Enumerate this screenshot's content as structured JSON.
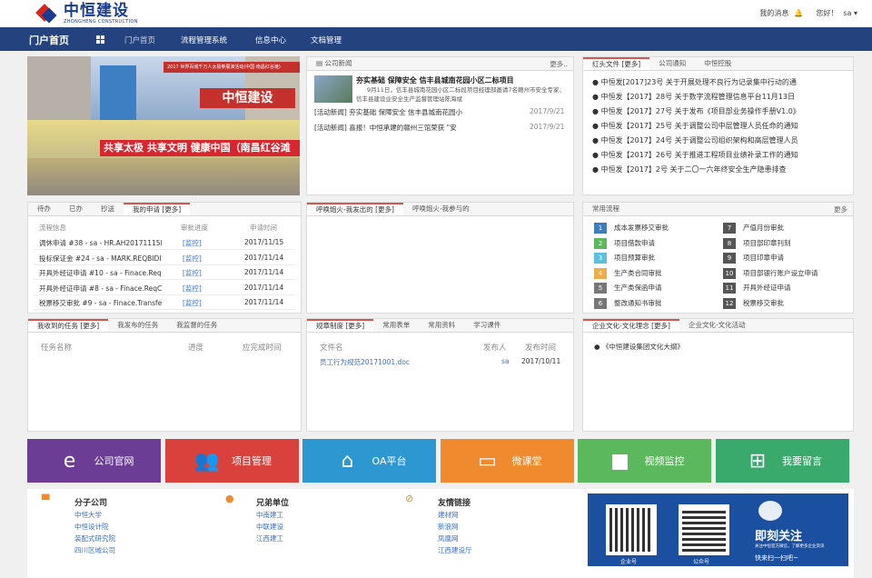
{
  "brand": {
    "cn": "中恒建设",
    "en": "ZHONGHENG CONSTRUCTION"
  },
  "user": {
    "messages": "我的消息",
    "greeting": "您好！",
    "name": "sa"
  },
  "nav": {
    "home": "门户首页",
    "items": [
      "门户首页",
      "流程管理系统",
      "信息中心",
      "文档管理"
    ]
  },
  "banner": {
    "headline": "共享太极 共享文明 健康中国（南昌红谷滩",
    "sign": "中恒建设",
    "top_strip": "2017 世界百城千万人太极拳展演活动(中国·南昌红谷滩)"
  },
  "company_news": {
    "title": "公司新闻",
    "more": "更多..",
    "featured_title": "夯实基础 保障安全 信丰县城南花园小区二标项目",
    "featured_text": "9月11日，信丰县城南花园小区二标段项目经理部邀请7名赣州市安全专家、信丰县建设业安全生产监督管理站陈海斌",
    "items": [
      {
        "text": "[活动新闻] 夯实基础 保障安全 信丰县城南花园小",
        "date": "2017/9/21"
      },
      {
        "text": "[活动新闻] 喜报！中恒承建的赣州三馆荣获 \"安",
        "date": "2017/9/21"
      }
    ]
  },
  "notices": {
    "tabs": [
      "红头文件 [更多]",
      "公司通知",
      "中恒控股"
    ],
    "items": [
      "中恒发[2017]23号 关于开展处理不良行为记录集中行动的通",
      "中恒发【2017】28号 关于数字流程管理信息平台11月13日",
      "中恒发【2017】27号 关于发布《项目部业务操作手册V1.0》",
      "中恒发【2017】25号 关于调整公司中层管理人员任命的通知",
      "中恒发【2017】24号 关于调整公司组织架构和高层管理人员",
      "中恒发【2017】26号 关于推进工程项目业绩补录工作的通知",
      "中恒发【2017】2号 关于二〇一六年终安全生产隐患排查"
    ]
  },
  "my_apply": {
    "tabs": [
      "待办",
      "已办",
      "抄送",
      "我的申请 [更多]"
    ],
    "headers": [
      "流程信息",
      "审批进度",
      "申请时间"
    ],
    "progress_label": "[监控]",
    "rows": [
      {
        "info": "调休申请 #38 - sa - HR.AH20171115I",
        "time": "2017/11/15"
      },
      {
        "info": "投标保证金 #24 - sa - MARK.REQBIDI",
        "time": "2017/11/14"
      },
      {
        "info": "开具外经证申请 #10 - sa - Finace.Req",
        "time": "2017/11/14"
      },
      {
        "info": "开具外经证申请 #8 - sa - Finace.ReqC",
        "time": "2017/11/14"
      },
      {
        "info": "税票移交审批 #9 - sa - Finace.Transfe",
        "time": "2017/11/14"
      }
    ]
  },
  "calls": {
    "tabs": [
      "呼唤炮火-我发出的 [更多]",
      "呼唤炮火-我参与的"
    ]
  },
  "common_flows": {
    "title": "常用流程",
    "more": "更多",
    "items": [
      {
        "n": "1",
        "label": "成本发票移交审批",
        "color": "#3b7dbf"
      },
      {
        "n": "2",
        "label": "项目借款申请",
        "color": "#5cb85c"
      },
      {
        "n": "3",
        "label": "项目预算审批",
        "color": "#5bc0de"
      },
      {
        "n": "4",
        "label": "生产类合同审批",
        "color": "#f0ad4e"
      },
      {
        "n": "5",
        "label": "生产类保函申请",
        "color": "#777777"
      },
      {
        "n": "6",
        "label": "整改通知书审批",
        "color": "#777777"
      },
      {
        "n": "7",
        "label": "产值月份审批",
        "color": "#555555"
      },
      {
        "n": "8",
        "label": "项目部印章刊刻",
        "color": "#555555"
      },
      {
        "n": "9",
        "label": "项目印章申请",
        "color": "#555555"
      },
      {
        "n": "10",
        "label": "项目部银行账户设立申请",
        "color": "#555555"
      },
      {
        "n": "11",
        "label": "开具外经证申请",
        "color": "#555555"
      },
      {
        "n": "12",
        "label": "税票移交审批",
        "color": "#555555"
      }
    ]
  },
  "tasks": {
    "tabs": [
      "我收到的任务 [更多]",
      "我发布的任务",
      "我监督的任务"
    ],
    "headers": [
      "任务名称",
      "进度",
      "应完成时间"
    ]
  },
  "rules": {
    "tabs": [
      "规章制度 [更多]",
      "常用表单",
      "常用资料",
      "学习课件"
    ],
    "headers": [
      "文件名",
      "发布人",
      "发布时间"
    ],
    "rows": [
      {
        "name": "员工行为规范20171001.doc",
        "by": "sa",
        "date": "2017/10/11"
      }
    ]
  },
  "culture": {
    "tabs": [
      "企业文化-文化理念 [更多]",
      "企业文化-文化活动"
    ],
    "items": [
      "《中恒建设集团文化大纲》"
    ]
  },
  "tiles": [
    {
      "label": "公司官网",
      "color": "#6b3d95",
      "icon": "ie-icon"
    },
    {
      "label": "项目管理",
      "color": "#d9413d",
      "icon": "people-icon"
    },
    {
      "label": "OA平台",
      "color": "#2d97d1",
      "icon": "home-icon"
    },
    {
      "label": "微课堂",
      "color": "#ef8a2e",
      "icon": "monitor-icon"
    },
    {
      "label": "视频监控",
      "color": "#5cb85c",
      "icon": "camera-icon"
    },
    {
      "label": "我要留言",
      "color": "#3aa96c",
      "icon": "sitemap-icon"
    }
  ],
  "footer": {
    "subsidiaries": {
      "title": "分子公司",
      "items": [
        "中恒大学",
        "中恒设计院",
        "装配式研究院",
        "四川区域公司"
      ]
    },
    "brothers": {
      "title": "兄弟单位",
      "items": [
        "中南建工",
        "中联建设",
        "江西建工"
      ]
    },
    "friends": {
      "title": "友情链接",
      "items": [
        "建材网",
        "新浪网",
        "凤凰网",
        "江西建设厅"
      ]
    },
    "qr": {
      "label1": "企业号",
      "label2": "公众号",
      "follow": "即刻关注",
      "sub": "关注中恒官方微信，了解更多企业资讯",
      "scan": "快来扫一扫吧~"
    }
  }
}
